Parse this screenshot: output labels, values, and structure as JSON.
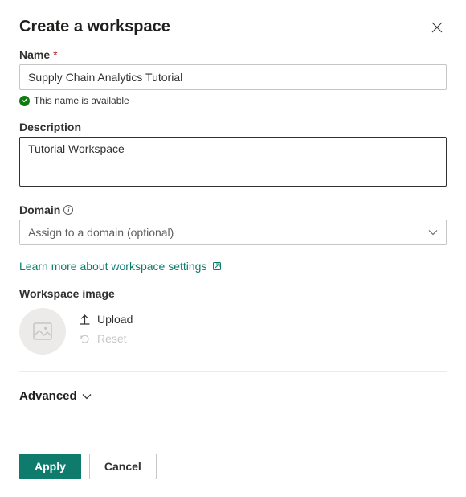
{
  "dialog": {
    "title": "Create a workspace"
  },
  "name": {
    "label": "Name",
    "value": "Supply Chain Analytics Tutorial",
    "availability": "This name is available"
  },
  "description": {
    "label": "Description",
    "value": "Tutorial Workspace"
  },
  "domain": {
    "label": "Domain",
    "placeholder": "Assign to a domain (optional)"
  },
  "link": {
    "text": "Learn more about workspace settings"
  },
  "workspace_image": {
    "label": "Workspace image",
    "upload": "Upload",
    "reset": "Reset"
  },
  "advanced": {
    "label": "Advanced"
  },
  "buttons": {
    "apply": "Apply",
    "cancel": "Cancel"
  }
}
